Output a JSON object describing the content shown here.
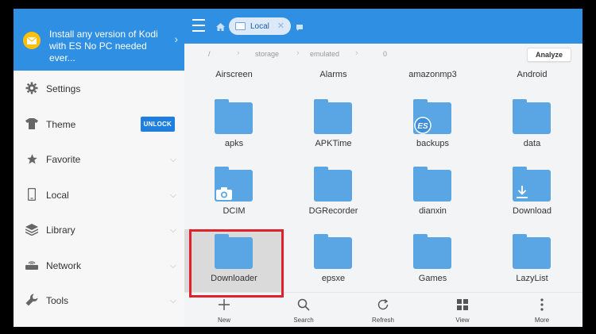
{
  "promo": {
    "text": "Install any version of Kodi with ES No PC needed ever..."
  },
  "sidebar": {
    "items": [
      {
        "label": "Settings",
        "icon": "gear-icon"
      },
      {
        "label": "Theme",
        "icon": "shirt-icon",
        "badge": "UNLOCK"
      },
      {
        "label": "Favorite",
        "icon": "star-icon"
      },
      {
        "label": "Local",
        "icon": "phone-icon"
      },
      {
        "label": "Library",
        "icon": "layers-icon"
      },
      {
        "label": "Network",
        "icon": "router-icon"
      },
      {
        "label": "Tools",
        "icon": "wrench-icon"
      }
    ]
  },
  "topbar": {
    "tab_label": "Local"
  },
  "breadcrumb": {
    "parts": [
      "/",
      "storage",
      "emulated",
      "0"
    ],
    "analyze": "Analyze"
  },
  "files": {
    "row0": [
      "Airscreen",
      "Alarms",
      "amazonmp3",
      "Android"
    ],
    "row1": [
      "apks",
      "APKTime",
      "backups",
      "data"
    ],
    "row2": [
      "DCIM",
      "DGRecorder",
      "dianxin",
      "Download"
    ],
    "row3": [
      "Downloader",
      "epsxe",
      "Games",
      "LazyList"
    ]
  },
  "bottombar": {
    "new": "New",
    "search": "Search",
    "refresh": "Refresh",
    "view": "View",
    "more": "More"
  },
  "colors": {
    "accent": "#2f8fe3",
    "folder": "#5aa5e4",
    "highlight": "#e0202a",
    "badge": "#1e7fe0"
  }
}
